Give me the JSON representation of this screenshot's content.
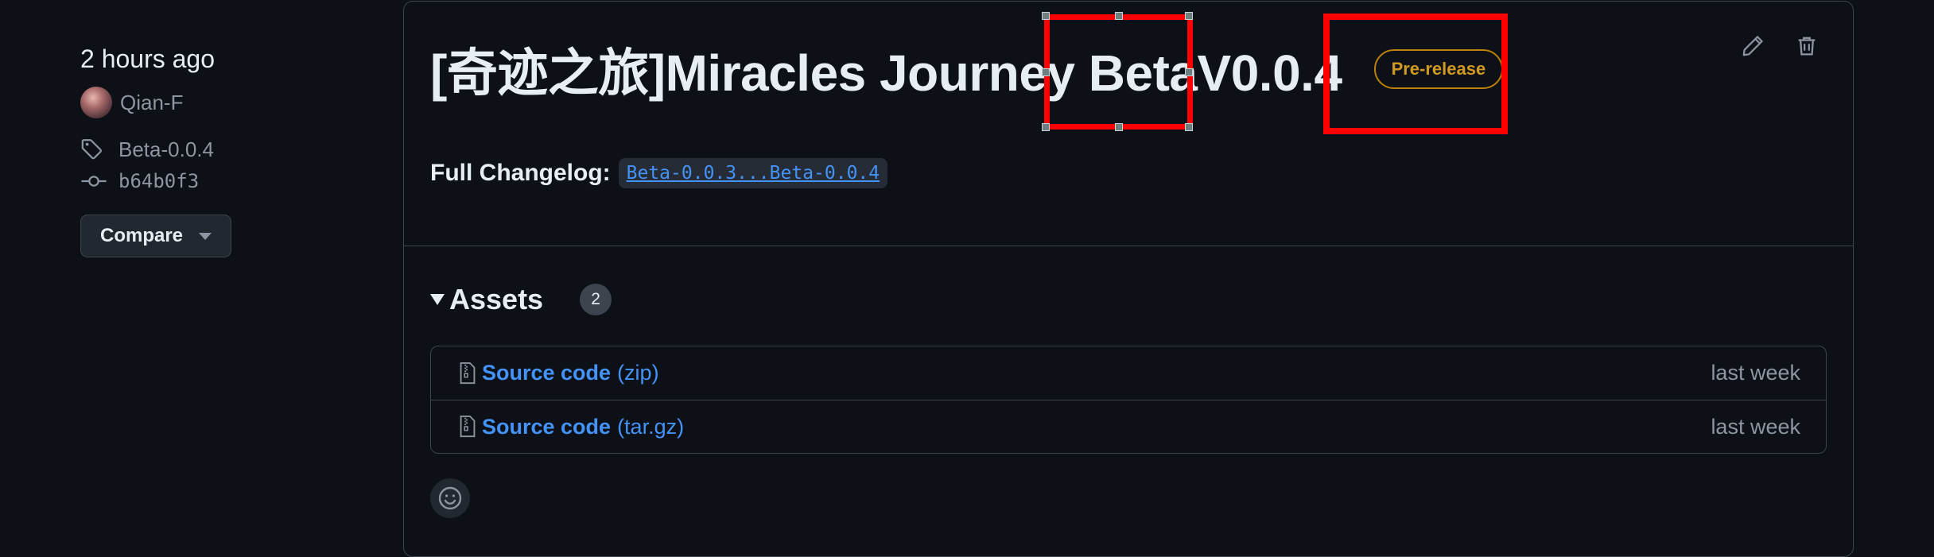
{
  "meta": {
    "time": "2 hours ago",
    "author": "Qian-F",
    "tag": "Beta-0.0.4",
    "commit": "b64b0f3",
    "compare_label": "Compare"
  },
  "release": {
    "title": "[奇迹之旅]Miracles Journey BetaV0.0.4",
    "badge": "Pre-release",
    "changelog_label": "Full Changelog:",
    "changelog_link": "Beta-0.0.3...Beta-0.0.4"
  },
  "assets": {
    "label": "Assets",
    "count": "2",
    "items": [
      {
        "name": "Source code",
        "ext": "(zip)",
        "when": "last week"
      },
      {
        "name": "Source code",
        "ext": "(tar.gz)",
        "when": "last week"
      }
    ]
  },
  "icons": {
    "tag": "tag-icon",
    "commit": "git-commit-icon",
    "edit": "pencil-icon",
    "delete": "trash-icon",
    "zip": "file-zip-icon",
    "emoji": "smiley-icon"
  },
  "colors": {
    "background": "#0d1117",
    "border": "#3d444d",
    "link": "#4493f8",
    "badge": "#d29922",
    "annotation": "#ff0000"
  }
}
